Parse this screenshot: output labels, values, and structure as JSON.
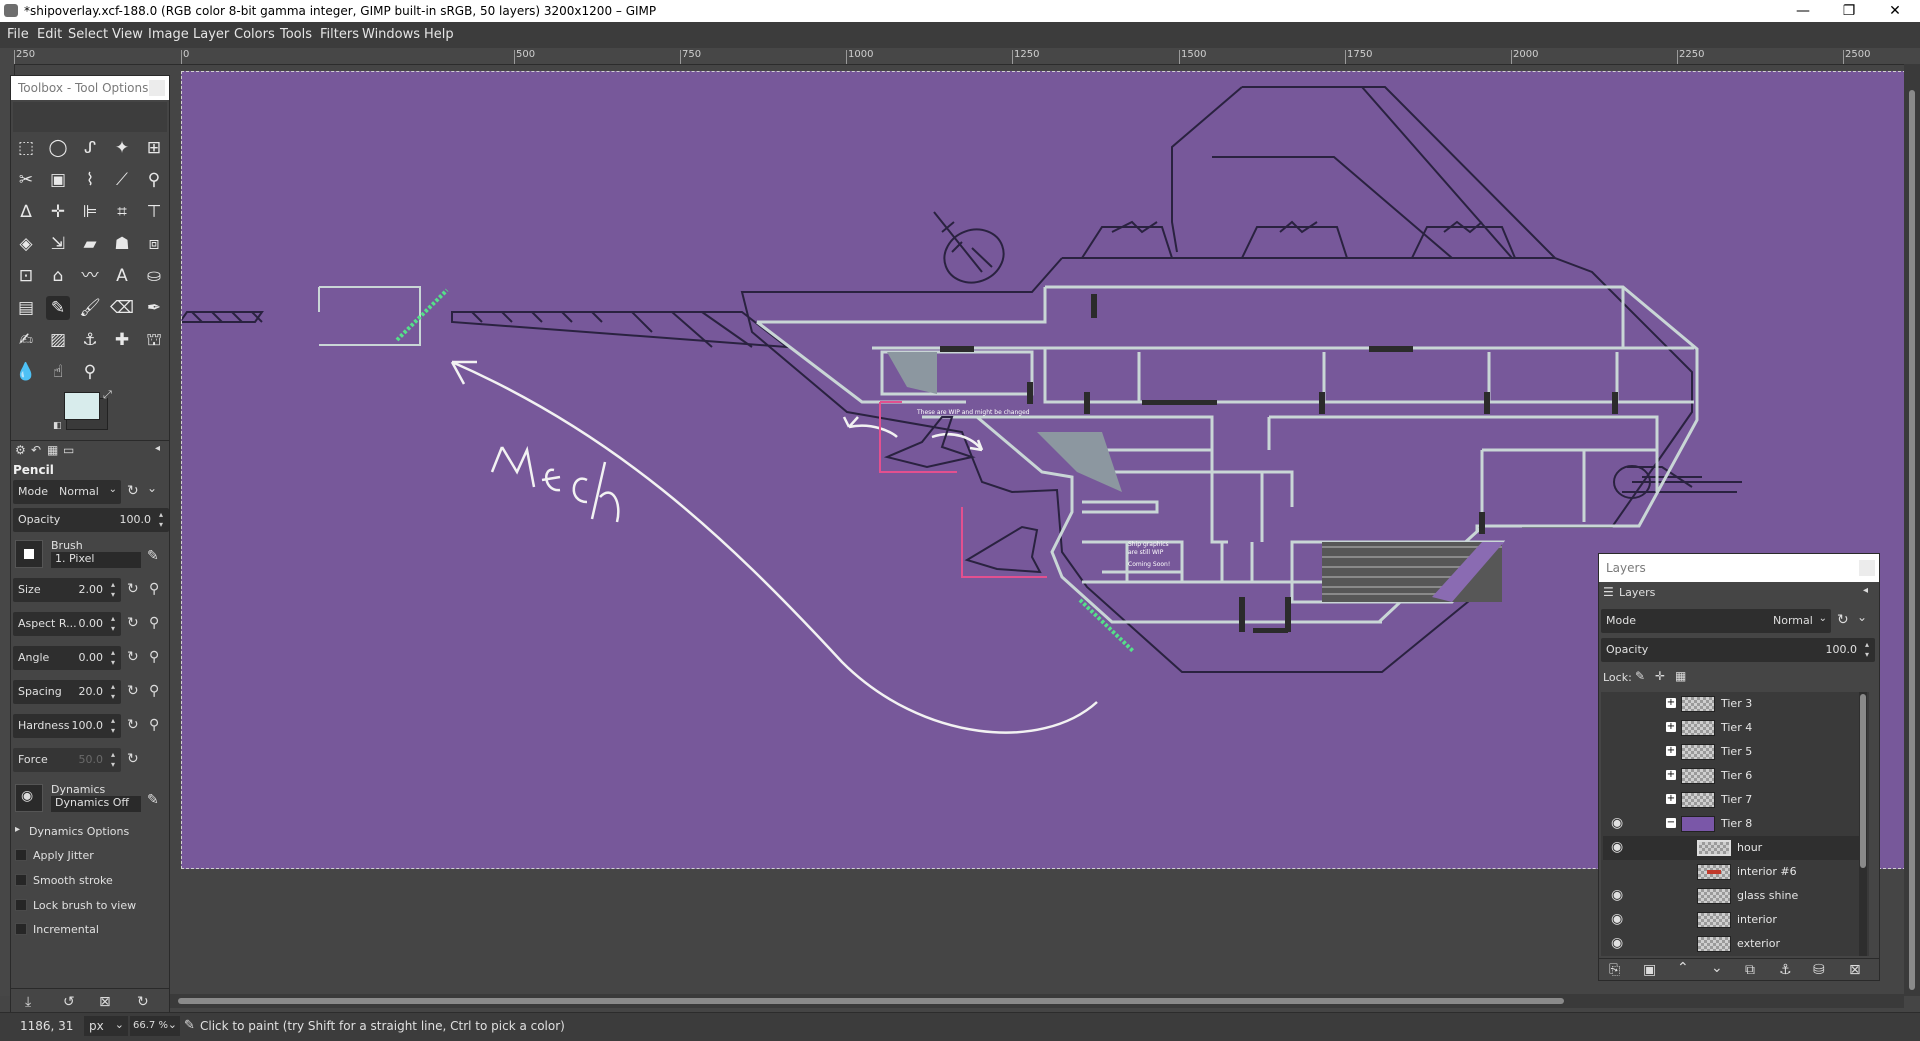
{
  "window": {
    "title": "*shipoverlay.xcf-188.0 (RGB color 8-bit gamma integer, GIMP built-in sRGB, 50 layers) 3200x1200 – GIMP",
    "minimize": "—",
    "maximize": "❐",
    "close": "✕"
  },
  "menu": [
    "File",
    "Edit",
    "Select",
    "View",
    "Image",
    "Layer",
    "Colors",
    "Tools",
    "Filters",
    "Windows",
    "Help"
  ],
  "ruler": {
    "labels": [
      "250",
      "0",
      "500",
      "750",
      "1000",
      "1250",
      "1500",
      "1750",
      "2000",
      "2250",
      "2500"
    ]
  },
  "canvas": {
    "background": "#77589a",
    "annotation_mech": "Mech",
    "note_top": "These are WIP and might be changed",
    "note_bottom_1": "Ship graphics",
    "note_bottom_2": "are still WIP",
    "note_bottom_3": "Coming Soon!"
  },
  "toolbox": {
    "title": "Toolbox - Tool Options",
    "tool_name": "Pencil",
    "mode_label": "Mode",
    "mode_value": "Normal",
    "opacity_label": "Opacity",
    "opacity_value": "100.0",
    "brush_label": "Brush",
    "brush_value": "1. Pixel",
    "size_label": "Size",
    "size_value": "2.00",
    "aspect_label": "Aspect R...",
    "aspect_value": "0.00",
    "angle_label": "Angle",
    "angle_value": "0.00",
    "spacing_label": "Spacing",
    "spacing_value": "20.0",
    "hardness_label": "Hardness",
    "hardness_value": "100.0",
    "force_label": "Force",
    "force_value": "50.0",
    "dynamics_label": "Dynamics",
    "dynamics_value": "Dynamics Off",
    "dynamics_options": "Dynamics Options",
    "apply_jitter": "Apply Jitter",
    "smooth_stroke": "Smooth stroke",
    "lock_brush": "Lock brush to view",
    "incremental": "Incremental",
    "fg_color": "#d8ecec",
    "bg_color": "#3a3a3a"
  },
  "layers": {
    "title": "Layers",
    "tab": "Layers",
    "mode_label": "Mode",
    "mode_value": "Normal",
    "opacity_label": "Opacity",
    "opacity_value": "100.0",
    "lock_label": "Lock:",
    "items": [
      {
        "name": "Tier 3",
        "visible": false,
        "group": true,
        "expanded": false,
        "indent": 0
      },
      {
        "name": "Tier 4",
        "visible": false,
        "group": true,
        "expanded": false,
        "indent": 0
      },
      {
        "name": "Tier 5",
        "visible": false,
        "group": true,
        "expanded": false,
        "indent": 0
      },
      {
        "name": "Tier 6",
        "visible": false,
        "group": true,
        "expanded": false,
        "indent": 0
      },
      {
        "name": "Tier 7",
        "visible": false,
        "group": true,
        "expanded": false,
        "indent": 0
      },
      {
        "name": "Tier 8",
        "visible": true,
        "group": true,
        "expanded": true,
        "indent": 0
      },
      {
        "name": "hour",
        "visible": true,
        "group": false,
        "indent": 1,
        "selected": true
      },
      {
        "name": "interior #6",
        "visible": false,
        "group": false,
        "indent": 1
      },
      {
        "name": "glass shine",
        "visible": true,
        "group": false,
        "indent": 1
      },
      {
        "name": "interior",
        "visible": true,
        "group": false,
        "indent": 1
      },
      {
        "name": "exterior",
        "visible": true,
        "group": false,
        "indent": 1
      }
    ]
  },
  "status": {
    "coords": "1186, 31",
    "unit": "px",
    "zoom": "66.7 %",
    "message": "Click to paint (try Shift for a straight line, Ctrl to pick a color)"
  }
}
